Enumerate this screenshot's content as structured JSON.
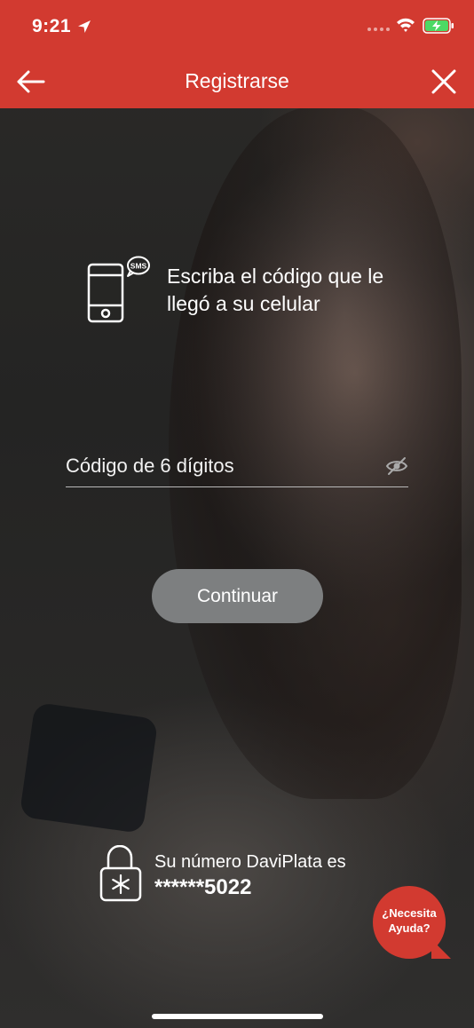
{
  "status_bar": {
    "time": "9:21",
    "icons": [
      "location-arrow-icon",
      "cellular-signal-icon",
      "wifi-icon",
      "battery-charging-icon"
    ]
  },
  "navbar": {
    "title": "Registrarse",
    "back_icon": "arrow-left-icon",
    "close_icon": "close-icon",
    "background_color": "#d23a30"
  },
  "instruction": {
    "icon": "phone-sms-icon",
    "icon_badge": "SMS",
    "text": "Escriba el código que le llegó a su celular"
  },
  "code_field": {
    "placeholder": "Código de 6 dígitos",
    "value": "",
    "toggle_icon": "eye-hidden-icon"
  },
  "continue_button": {
    "label": "Continuar",
    "state": "disabled",
    "color": "#7d7f80"
  },
  "phone_info": {
    "icon": "lock-asterisk-icon",
    "label": "Su número DaviPlata es",
    "number": "******5022"
  },
  "help": {
    "label": "¿Necesita\nAyuda?",
    "color": "#d23a30"
  }
}
